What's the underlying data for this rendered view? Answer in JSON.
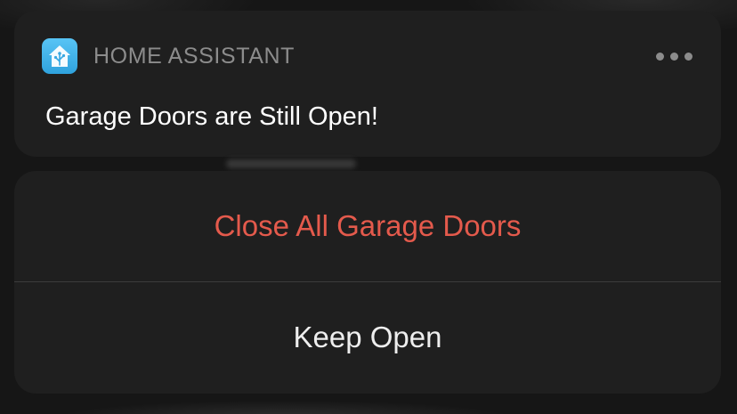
{
  "notification": {
    "app_name": "HOME ASSISTANT",
    "app_icon": "home-assistant-icon",
    "more_icon": "ellipsis-icon",
    "message": "Garage Doors are Still Open!"
  },
  "actions": [
    {
      "label": "Close All Garage Doors",
      "style": "destructive",
      "color": "#e45a4c"
    },
    {
      "label": "Keep Open",
      "style": "default",
      "color": "#eeeeee"
    }
  ],
  "colors": {
    "background": "#161616",
    "card": "#1f1f1f",
    "app_icon": "#41b6ee",
    "secondary_text": "#8c8c8c"
  }
}
